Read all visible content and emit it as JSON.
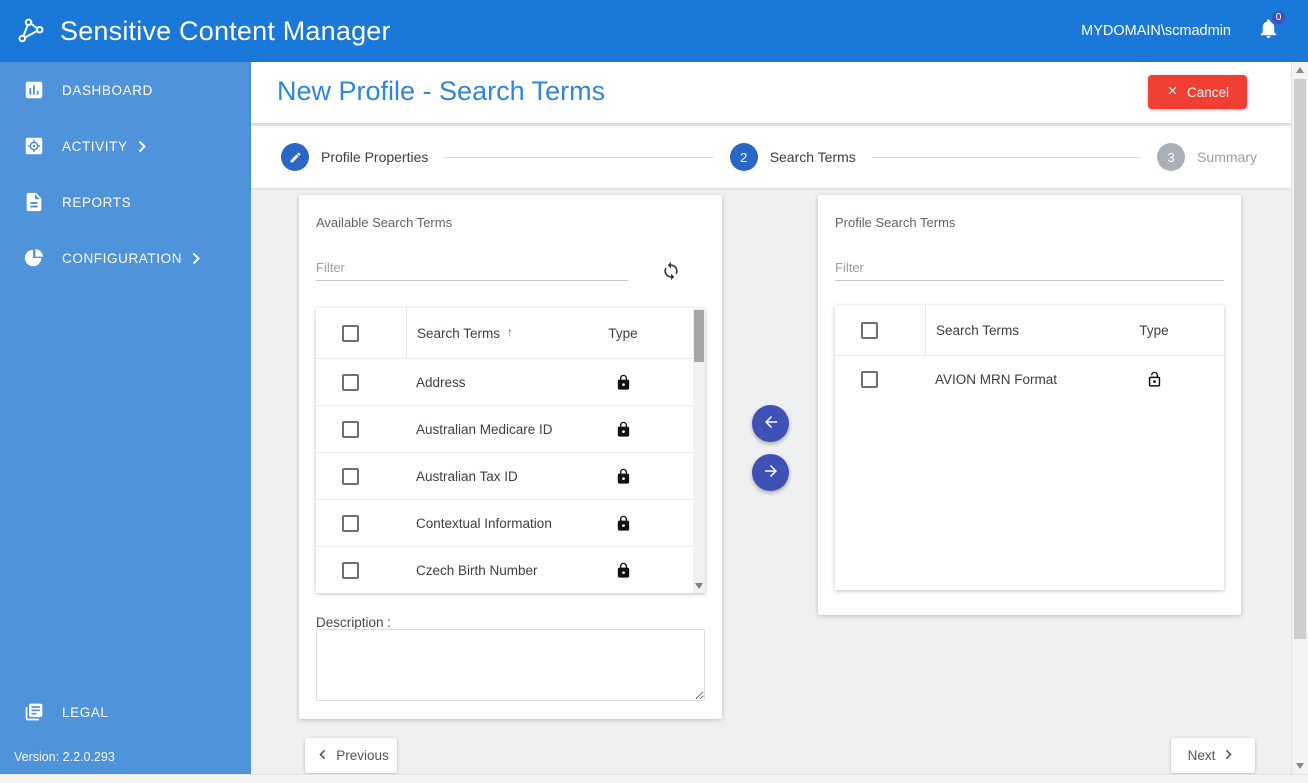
{
  "header": {
    "title": "Sensitive Content Manager",
    "user": "MYDOMAIN\\scmadmin",
    "notification_count": "0"
  },
  "sidebar": {
    "items": [
      {
        "label": "DASHBOARD",
        "icon": "dashboard-icon",
        "expandable": false
      },
      {
        "label": "ACTIVITY",
        "icon": "activity-icon",
        "expandable": true
      },
      {
        "label": "REPORTS",
        "icon": "reports-icon",
        "expandable": false
      },
      {
        "label": "CONFIGURATION",
        "icon": "configuration-icon",
        "expandable": true
      }
    ],
    "legal_label": "LEGAL",
    "version": "Version: 2.2.0.293"
  },
  "page": {
    "title": "New Profile - Search Terms",
    "cancel_label": "Cancel"
  },
  "stepper": {
    "steps": [
      {
        "label": "Profile Properties",
        "icon": "edit-icon",
        "state": "completed"
      },
      {
        "number": "2",
        "label": "Search Terms",
        "state": "active"
      },
      {
        "number": "3",
        "label": "Summary",
        "state": "pending"
      }
    ]
  },
  "available_panel": {
    "title": "Available Search Terms",
    "filter_placeholder": "Filter",
    "refresh_icon": "sync-icon",
    "table": {
      "headers": {
        "search_terms": "Search Terms",
        "type": "Type",
        "sort_indicator": "↑"
      },
      "rows": [
        {
          "name": "Address",
          "locked": true
        },
        {
          "name": "Australian Medicare ID",
          "locked": true
        },
        {
          "name": "Australian Tax ID",
          "locked": true
        },
        {
          "name": "Contextual Information",
          "locked": true
        },
        {
          "name": "Czech Birth Number",
          "locked": true
        }
      ]
    },
    "description_label": "Description :",
    "description_value": ""
  },
  "profile_panel": {
    "title": "Profile Search Terms",
    "filter_placeholder": "Filter",
    "table": {
      "headers": {
        "search_terms": "Search Terms",
        "type": "Type"
      },
      "rows": [
        {
          "name": "AVION MRN Format",
          "locked": false
        }
      ]
    }
  },
  "footer": {
    "previous_label": "Previous",
    "next_label": "Next"
  },
  "colors": {
    "header_blue": "#1a78d9",
    "sidebar_blue": "#4f93da",
    "title_blue": "#2f86d8",
    "cancel_red": "#f23f33",
    "step_blue": "#2a67c5",
    "transfer_indigo": "#3f51b5"
  }
}
